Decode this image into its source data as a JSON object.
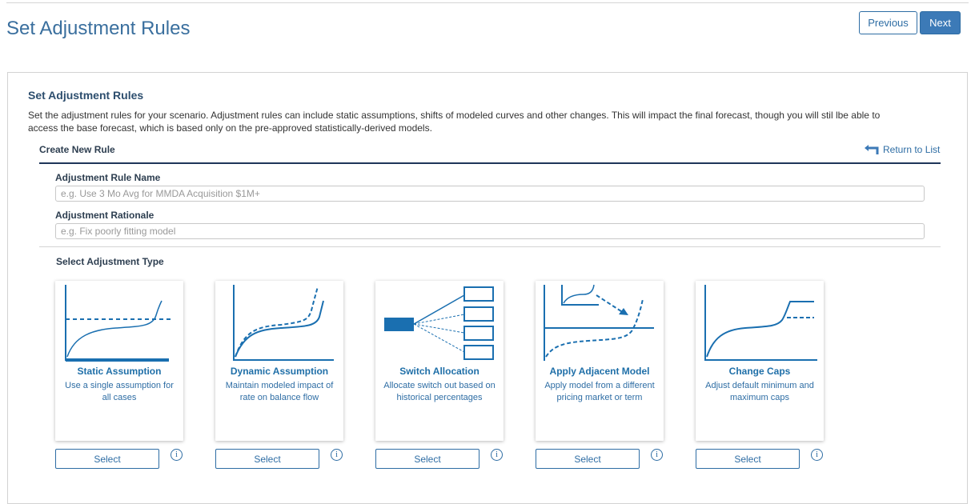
{
  "header": {
    "title": "Set Adjustment Rules",
    "previous_label": "Previous",
    "next_label": "Next"
  },
  "panel": {
    "title": "Set Adjustment Rules",
    "description": "Set the adjustment rules for your scenario. Adjustment rules can include static assumptions, shifts of modeled curves and other changes. This will impact the final forecast, though you will stil lbe able to access the base forecast, which is based only on the pre-approved statistically-derived models."
  },
  "create_rule": {
    "section_title": "Create New Rule",
    "return_label": "Return to List",
    "name_label": "Adjustment Rule Name",
    "name_value": "",
    "name_placeholder": "e.g. Use 3 Mo Avg for MMDA Acquisition $1M+",
    "rationale_label": "Adjustment Rationale",
    "rationale_value": "",
    "rationale_placeholder": "e.g. Fix poorly fitting model",
    "type_title": "Select Adjustment Type"
  },
  "adjustment_types": [
    {
      "title": "Static Assumption",
      "description": "Use a single assumption for all cases",
      "select_label": "Select",
      "info_label": "i",
      "icon": "static-assumption-chart-icon"
    },
    {
      "title": "Dynamic Assumption",
      "description": "Maintain modeled impact of rate on balance flow",
      "select_label": "Select",
      "info_label": "i",
      "icon": "dynamic-assumption-chart-icon"
    },
    {
      "title": "Switch Allocation",
      "description": "Allocate switch out based on historical percentages",
      "select_label": "Select",
      "info_label": "i",
      "icon": "switch-allocation-diagram-icon"
    },
    {
      "title": "Apply Adjacent Model",
      "description": "Apply model from a different pricing market or term",
      "select_label": "Select",
      "info_label": "i",
      "icon": "adjacent-model-chart-icon"
    },
    {
      "title": "Change Caps",
      "description": "Adjust default minimum and maximum caps",
      "select_label": "Select",
      "info_label": "i",
      "icon": "change-caps-chart-icon"
    }
  ],
  "colors": {
    "accent": "#1a6fb0",
    "title_blue": "#3a6f9e",
    "next_button": "#3c7ab7",
    "rule_navy": "#1f3559"
  }
}
